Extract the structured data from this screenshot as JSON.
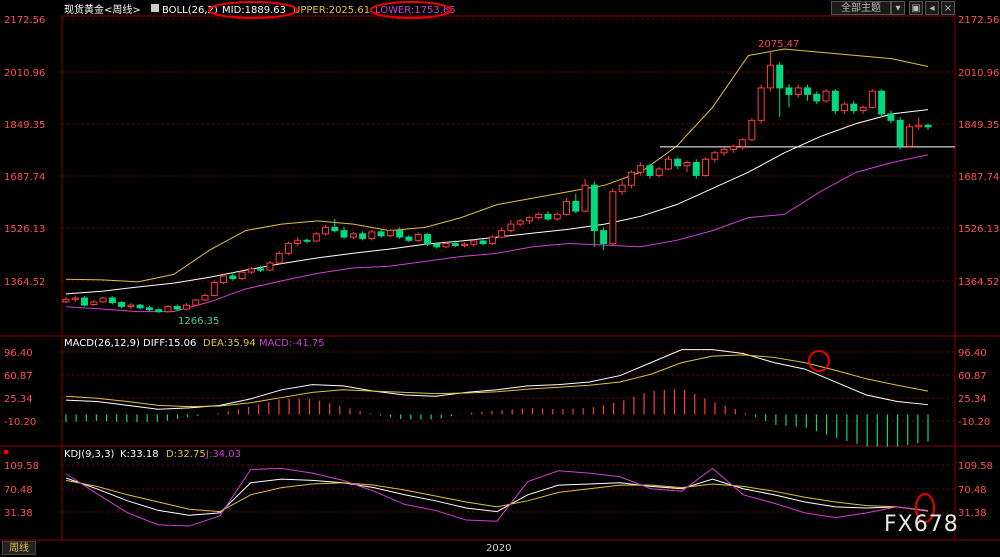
{
  "header": {
    "symbol": "现货黄金<周线>",
    "boll": "BOLL(26,2)",
    "mid": "MID:1889.63",
    "upper": "UPPER:2025.61",
    "lower": "LOWER:1753.65",
    "toolbar_button": "全部主题"
  },
  "macd_header": {
    "name": "MACD(26,12,9)",
    "diff": "DIFF:15.06",
    "dea": "DEA:35.94",
    "macd": "MACD:-41.75"
  },
  "kdj_header": {
    "name": "KDJ(9,3,3)",
    "k": "K:33.18",
    "d": "D:32.75",
    "j": "J:34.03"
  },
  "footer": {
    "period_tab": "周线",
    "x_label": "2020"
  },
  "watermark": "FX678",
  "annotations": {
    "high": "2075.47",
    "low": "1266.35"
  },
  "colors": {
    "up": "#ff3b3b",
    "down": "#00d97e",
    "mid": "#ffffff",
    "upper": "#e0c040",
    "lower": "#d040d0",
    "grid": "#7a0000"
  },
  "chart_data": [
    {
      "type": "candlestick",
      "y_ticks": [
        "2172.56",
        "2010.96",
        "1849.35",
        "1687.74",
        "1526.13",
        "1364.52"
      ],
      "ylim": [
        1250,
        2180
      ],
      "horizontal_line": 1778,
      "series": [
        {
          "name": "MID",
          "values": [
            1325,
            1333,
            1346,
            1358,
            1376,
            1398,
            1418,
            1436,
            1450,
            1463,
            1478,
            1488,
            1500,
            1512,
            1524,
            1540,
            1564,
            1600,
            1650,
            1700,
            1760,
            1810,
            1850,
            1880,
            1893
          ]
        },
        {
          "name": "UPPER",
          "values": [
            1370,
            1368,
            1362,
            1385,
            1460,
            1520,
            1540,
            1550,
            1540,
            1520,
            1530,
            1560,
            1600,
            1620,
            1640,
            1660,
            1700,
            1780,
            1900,
            2060,
            2080,
            2070,
            2060,
            2050,
            2026
          ]
        },
        {
          "name": "LOWER",
          "values": [
            1285,
            1278,
            1270,
            1270,
            1300,
            1340,
            1365,
            1388,
            1405,
            1410,
            1425,
            1440,
            1450,
            1470,
            1480,
            1475,
            1470,
            1490,
            1520,
            1560,
            1570,
            1640,
            1700,
            1730,
            1754
          ]
        }
      ],
      "candles": [
        [
          1300,
          1308,
          1316,
          1296
        ],
        [
          1308,
          1312,
          1320,
          1300
        ],
        [
          1312,
          1290,
          1318,
          1286
        ],
        [
          1292,
          1300,
          1306,
          1288
        ],
        [
          1300,
          1312,
          1316,
          1296
        ],
        [
          1312,
          1298,
          1318,
          1292
        ],
        [
          1298,
          1286,
          1302,
          1280
        ],
        [
          1286,
          1290,
          1296,
          1278
        ],
        [
          1290,
          1282,
          1294,
          1276
        ],
        [
          1282,
          1276,
          1288,
          1272
        ],
        [
          1276,
          1270,
          1282,
          1266
        ],
        [
          1270,
          1286,
          1290,
          1266
        ],
        [
          1286,
          1278,
          1292,
          1272
        ],
        [
          1278,
          1290,
          1296,
          1274
        ],
        [
          1290,
          1306,
          1310,
          1286
        ],
        [
          1306,
          1320,
          1326,
          1302
        ],
        [
          1320,
          1360,
          1366,
          1318
        ],
        [
          1360,
          1380,
          1388,
          1354
        ],
        [
          1380,
          1372,
          1392,
          1366
        ],
        [
          1372,
          1392,
          1398,
          1368
        ],
        [
          1392,
          1402,
          1408,
          1386
        ],
        [
          1402,
          1398,
          1412,
          1392
        ],
        [
          1398,
          1420,
          1426,
          1394
        ],
        [
          1420,
          1450,
          1456,
          1414
        ],
        [
          1450,
          1480,
          1486,
          1444
        ],
        [
          1480,
          1490,
          1500,
          1472
        ],
        [
          1490,
          1488,
          1496,
          1480
        ],
        [
          1488,
          1510,
          1516,
          1484
        ],
        [
          1510,
          1530,
          1538,
          1504
        ],
        [
          1530,
          1520,
          1556,
          1514
        ],
        [
          1520,
          1500,
          1532,
          1494
        ],
        [
          1500,
          1510,
          1516,
          1494
        ],
        [
          1510,
          1496,
          1518,
          1490
        ],
        [
          1496,
          1516,
          1522,
          1490
        ],
        [
          1516,
          1504,
          1524,
          1498
        ],
        [
          1504,
          1520,
          1526,
          1500
        ],
        [
          1520,
          1500,
          1530,
          1494
        ],
        [
          1500,
          1490,
          1506,
          1484
        ],
        [
          1490,
          1508,
          1514,
          1484
        ],
        [
          1508,
          1478,
          1512,
          1472
        ],
        [
          1478,
          1470,
          1484,
          1464
        ],
        [
          1470,
          1480,
          1486,
          1466
        ],
        [
          1480,
          1474,
          1490,
          1470
        ],
        [
          1474,
          1478,
          1484,
          1468
        ],
        [
          1478,
          1488,
          1494,
          1470
        ],
        [
          1488,
          1480,
          1494,
          1474
        ],
        [
          1480,
          1500,
          1506,
          1476
        ],
        [
          1500,
          1520,
          1530,
          1496
        ],
        [
          1520,
          1540,
          1552,
          1514
        ],
        [
          1540,
          1550,
          1556,
          1532
        ],
        [
          1550,
          1560,
          1566,
          1540
        ],
        [
          1560,
          1570,
          1576,
          1552
        ],
        [
          1570,
          1556,
          1580,
          1550
        ],
        [
          1556,
          1570,
          1576,
          1550
        ],
        [
          1570,
          1610,
          1620,
          1566
        ],
        [
          1610,
          1580,
          1634,
          1574
        ],
        [
          1580,
          1660,
          1680,
          1576
        ],
        [
          1660,
          1520,
          1672,
          1470
        ],
        [
          1520,
          1480,
          1530,
          1460
        ],
        [
          1480,
          1640,
          1650,
          1474
        ],
        [
          1640,
          1660,
          1676,
          1630
        ],
        [
          1660,
          1700,
          1706,
          1650
        ],
        [
          1700,
          1720,
          1730,
          1690
        ],
        [
          1720,
          1690,
          1726,
          1680
        ],
        [
          1690,
          1710,
          1716,
          1684
        ],
        [
          1710,
          1740,
          1750,
          1706
        ],
        [
          1740,
          1720,
          1746,
          1710
        ],
        [
          1720,
          1730,
          1736,
          1700
        ],
        [
          1730,
          1690,
          1740,
          1680
        ],
        [
          1690,
          1740,
          1746,
          1686
        ],
        [
          1740,
          1760,
          1766,
          1730
        ],
        [
          1760,
          1770,
          1776,
          1750
        ],
        [
          1770,
          1780,
          1786,
          1760
        ],
        [
          1780,
          1800,
          1806,
          1770
        ],
        [
          1800,
          1860,
          1866,
          1796
        ],
        [
          1860,
          1960,
          1970,
          1850
        ],
        [
          1960,
          2030,
          2075,
          1950
        ],
        [
          2030,
          1960,
          2040,
          1870
        ],
        [
          1960,
          1940,
          1972,
          1900
        ],
        [
          1940,
          1960,
          1970,
          1930
        ],
        [
          1960,
          1940,
          1970,
          1920
        ],
        [
          1940,
          1920,
          1950,
          1910
        ],
        [
          1920,
          1950,
          1956,
          1914
        ],
        [
          1950,
          1890,
          1956,
          1880
        ],
        [
          1890,
          1910,
          1916,
          1880
        ],
        [
          1910,
          1890,
          1920,
          1880
        ],
        [
          1890,
          1900,
          1906,
          1880
        ],
        [
          1900,
          1950,
          1956,
          1896
        ],
        [
          1950,
          1880,
          1956,
          1870
        ],
        [
          1880,
          1860,
          1890,
          1850
        ],
        [
          1860,
          1780,
          1870,
          1770
        ],
        [
          1780,
          1840,
          1850,
          1776
        ],
        [
          1840,
          1845,
          1870,
          1830
        ],
        [
          1845,
          1840,
          1850,
          1830
        ]
      ]
    },
    {
      "type": "macd",
      "y_ticks": [
        "96.40",
        "60.87",
        "25.34",
        "-10.20"
      ],
      "ylim": [
        -45,
        110
      ],
      "series": [
        {
          "name": "DIFF",
          "values": [
            22,
            20,
            14,
            8,
            10,
            14,
            24,
            38,
            46,
            44,
            36,
            30,
            28,
            34,
            38,
            44,
            46,
            50,
            60,
            80,
            100,
            100,
            94,
            80,
            70,
            50,
            30,
            20,
            15
          ]
        },
        {
          "name": "DEA",
          "values": [
            28,
            25,
            20,
            14,
            12,
            13,
            18,
            26,
            34,
            38,
            36,
            34,
            32,
            33,
            35,
            39,
            42,
            45,
            50,
            62,
            80,
            90,
            92,
            88,
            80,
            68,
            55,
            45,
            36
          ]
        }
      ]
    },
    {
      "type": "kdj",
      "y_ticks": [
        "109.58",
        "70.48",
        "31.38"
      ],
      "ylim": [
        -5,
        125
      ],
      "series": [
        {
          "name": "K",
          "values": [
            88,
            70,
            50,
            34,
            26,
            30,
            80,
            86,
            84,
            80,
            72,
            60,
            50,
            38,
            32,
            60,
            76,
            78,
            80,
            74,
            70,
            86,
            70,
            60,
            48,
            40,
            38,
            40,
            33
          ]
        },
        {
          "name": "D",
          "values": [
            84,
            74,
            60,
            48,
            36,
            32,
            60,
            72,
            78,
            80,
            76,
            68,
            58,
            48,
            40,
            50,
            64,
            70,
            76,
            76,
            72,
            78,
            74,
            66,
            56,
            48,
            42,
            40,
            33
          ]
        },
        {
          "name": "J",
          "values": [
            95,
            62,
            30,
            10,
            8,
            25,
            102,
            104,
            96,
            84,
            66,
            44,
            34,
            18,
            16,
            82,
            100,
            96,
            90,
            70,
            66,
            104,
            60,
            46,
            30,
            22,
            30,
            40,
            34
          ]
        }
      ]
    }
  ]
}
